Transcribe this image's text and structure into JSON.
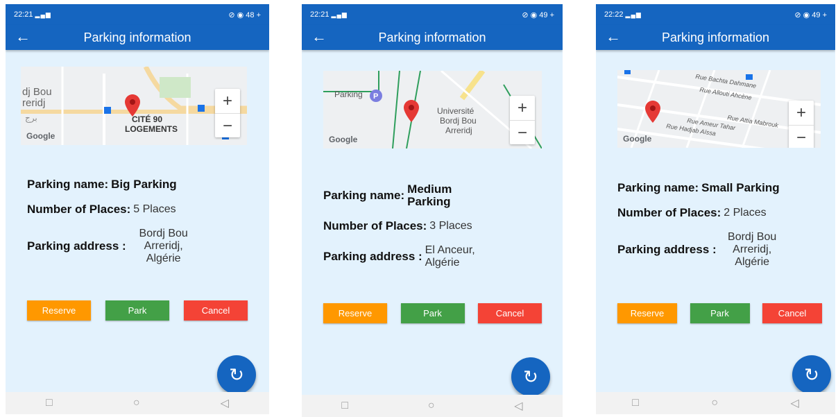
{
  "screens": [
    {
      "status_time": "22:21",
      "status_icons": "⊘ ◉ 48 +",
      "title": "Parking information",
      "map": {
        "google": "Google",
        "labels": [
          "dj Bou",
          "reridj",
          "CITÉ 90",
          "LOGEMENTS",
          "برج"
        ]
      },
      "name_label": "Parking name:",
      "name_value": "Big Parking",
      "places_label": "Number of Places:",
      "places_value": "5 Places",
      "address_label": "Parking address :",
      "address_value": "Bordj Bou Arreridj, Algérie",
      "buttons": {
        "reserve": "Reserve",
        "park": "Park",
        "cancel": "Cancel"
      }
    },
    {
      "status_time": "22:21",
      "status_icons": "⊘ ◉ 49 +",
      "title": "Parking information",
      "map": {
        "google": "Google",
        "labels": [
          "Parking",
          "Université",
          "Bordj Bou",
          "Arreridj"
        ]
      },
      "name_label": "Parking name:",
      "name_value": "Medium Parking",
      "places_label": "Number of Places:",
      "places_value": "3 Places",
      "address_label": "Parking address :",
      "address_value": "El Anceur, Algérie",
      "buttons": {
        "reserve": "Reserve",
        "park": "Park",
        "cancel": "Cancel"
      }
    },
    {
      "status_time": "22:22",
      "status_icons": "⊘ ◉ 49 +",
      "title": "Parking information",
      "map": {
        "google": "Google",
        "labels": [
          "Rue Bachta Dahmane",
          "Rue Allouti Ahcène",
          "Rue Attia Mabrouk",
          "Rue Ameur Tahar",
          "Rue Hadjab Aïssa"
        ]
      },
      "name_label": "Parking name:",
      "name_value": "Small Parking",
      "places_label": "Number of Places:",
      "places_value": "2 Places",
      "address_label": "Parking address :",
      "address_value": "Bordj Bou Arreridj, Algérie",
      "buttons": {
        "reserve": "Reserve",
        "park": "Park",
        "cancel": "Cancel"
      }
    }
  ],
  "icons": {
    "back": "arrow-left-icon",
    "refresh": "refresh-icon",
    "pin": "map-pin-icon",
    "zoom_in": "plus-icon",
    "zoom_out": "minus-icon"
  },
  "colors": {
    "primary": "#1565c0",
    "background": "#e3f2fd",
    "reserve": "#ff9800",
    "park": "#43a047",
    "cancel": "#f44336",
    "pin": "#e53935"
  }
}
